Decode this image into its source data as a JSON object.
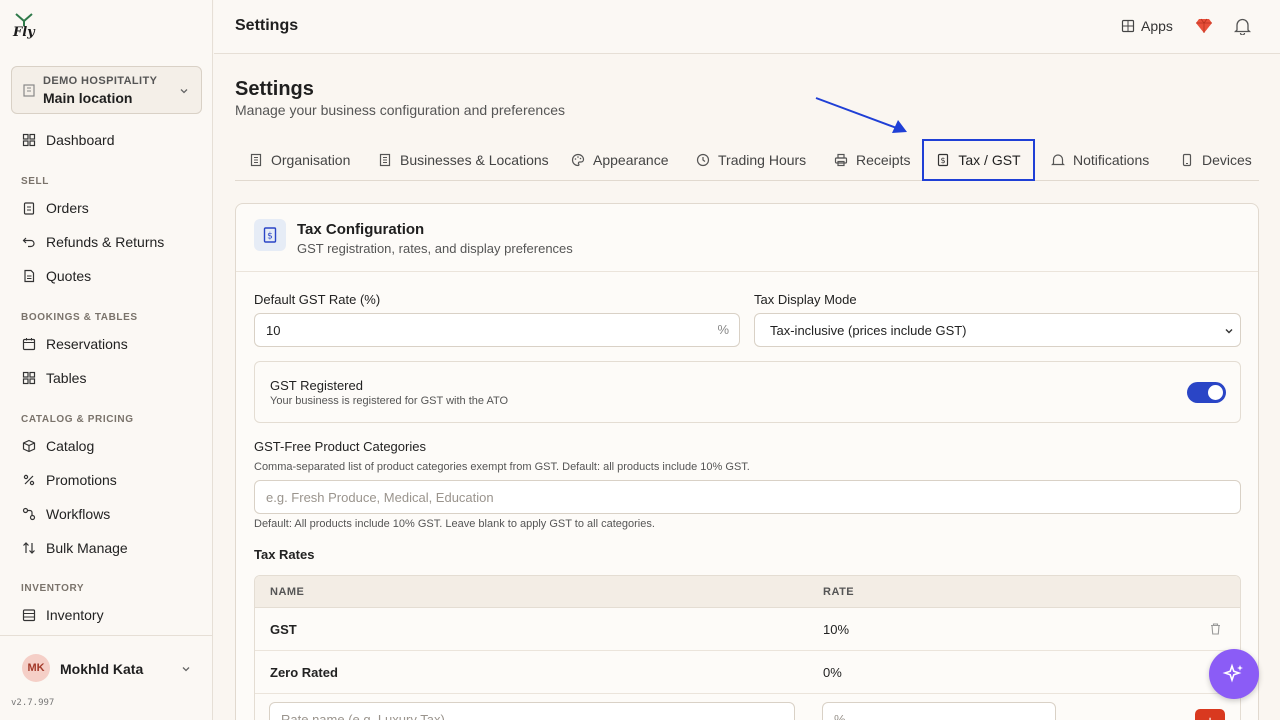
{
  "app": {
    "logo_text": "Fly"
  },
  "location": {
    "org": "DEMO HOSPITALITY",
    "name": "Main location"
  },
  "sidebar": {
    "dashboard": "Dashboard",
    "sec_sell": "SELL",
    "orders": "Orders",
    "refunds": "Refunds & Returns",
    "quotes": "Quotes",
    "sec_bookings": "BOOKINGS & TABLES",
    "reservations": "Reservations",
    "tables": "Tables",
    "sec_catalog": "CATALOG & PRICING",
    "catalog": "Catalog",
    "promotions": "Promotions",
    "workflows": "Workflows",
    "bulk": "Bulk Manage",
    "sec_inventory": "INVENTORY",
    "inventory": "Inventory"
  },
  "user": {
    "initials": "MK",
    "name": "Mokhld Kata",
    "version": "v2.7.997"
  },
  "header": {
    "title": "Settings",
    "apps_label": "Apps"
  },
  "page": {
    "title": "Settings",
    "subtitle": "Manage your business configuration and preferences"
  },
  "tabs": {
    "organisation": "Organisation",
    "businesses": "Businesses & Locations",
    "appearance": "Appearance",
    "trading": "Trading Hours",
    "receipts": "Receipts",
    "tax": "Tax / GST",
    "notifications": "Notifications",
    "devices": "Devices"
  },
  "tax": {
    "title": "Tax Configuration",
    "subtitle": "GST registration, rates, and display preferences",
    "rate_label": "Default GST Rate (%)",
    "rate_value": "10",
    "rate_suffix": "%",
    "mode_label": "Tax Display Mode",
    "mode_value": "Tax-inclusive (prices include GST)",
    "registered_title": "GST Registered",
    "registered_desc": "Your business is registered for GST with the ATO",
    "registered_on": true,
    "free_label": "GST-Free Product Categories",
    "free_help": "Comma-separated list of product categories exempt from GST. Default: all products include 10% GST.",
    "free_placeholder": "e.g. Fresh Produce, Medical, Education",
    "free_note": "Default: All products include 10% GST. Leave blank to apply GST to all categories.",
    "rates_heading": "Tax Rates",
    "col_name": "NAME",
    "col_rate": "RATE",
    "rows": [
      {
        "name": "GST",
        "rate": "10%"
      },
      {
        "name": "Zero Rated",
        "rate": "0%"
      }
    ],
    "new_name_placeholder": "Rate name (e.g. Luxury Tax)",
    "new_rate_placeholder": "%",
    "add_label": "+"
  },
  "colors": {
    "accent": "#1f3fd6",
    "toggle": "#2a45c6",
    "danger": "#d9391f",
    "fab": "#8b5cf6"
  }
}
